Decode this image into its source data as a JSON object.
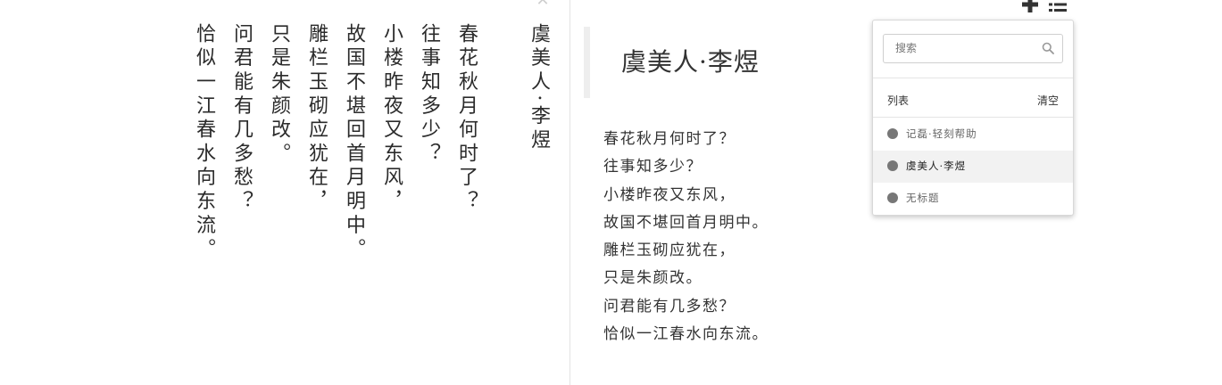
{
  "editor": {
    "close_icon": "close-icon",
    "columns": [
      "虞美人·李煜",
      "春花秋月何时了？",
      "往事知多少？",
      "小楼昨夜又东风，",
      "故国不堪回首月明中。",
      "雕栏玉砌应犹在，",
      "只是朱颜改。",
      "问君能有几多愁？",
      "恰似一江春水向东流。"
    ]
  },
  "preview": {
    "title": "虞美人·李煜",
    "lines": [
      "春花秋月何时了？",
      "往事知多少？",
      "小楼昨夜又东风，",
      "故国不堪回首月明中。",
      "雕栏玉砌应犹在，",
      "只是朱颜改。",
      "问君能有几多愁？",
      "恰似一江春水向东流。"
    ]
  },
  "toolbar": {
    "add_icon": "plus-icon",
    "list_icon": "list-icon"
  },
  "panel": {
    "search_placeholder": "搜索",
    "search_icon": "search-icon",
    "list_label": "列表",
    "clear_label": "清空",
    "items": [
      {
        "label": "记磊·轻刻帮助",
        "active": false
      },
      {
        "label": "虞美人·李煜",
        "active": true
      },
      {
        "label": "无标题",
        "active": false
      }
    ]
  },
  "colors": {
    "dot": "#777777",
    "active_row": "#f2f2f2",
    "quote_bar": "#eeeeee"
  }
}
